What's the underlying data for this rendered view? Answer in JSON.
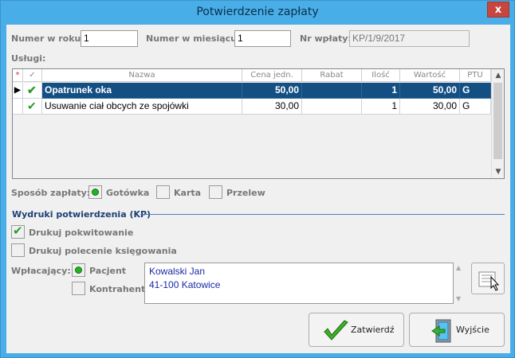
{
  "window": {
    "title": "Potwierdzenie zapłaty",
    "close_glyph": "x"
  },
  "fields": {
    "numer_w_roku_label": "Numer w roku:",
    "numer_w_roku_value": "1",
    "numer_w_miesiacu_label": "Numer w miesiącu:",
    "numer_w_miesiacu_value": "1",
    "nr_wplaty_label": "Nr wpłaty:",
    "nr_wplaty_value": "KP/1/9/2017"
  },
  "services": {
    "label": "Usługi:",
    "columns": [
      "*",
      "✓",
      "Nazwa",
      "Cena jedn.",
      "Rabat",
      "Ilość",
      "Wartość",
      "PTU"
    ],
    "rows": [
      {
        "name": "Opatrunek oka",
        "price": "50,00",
        "discount": "",
        "qty": "1",
        "value": "50,00",
        "ptu": "G"
      },
      {
        "name": "Usuwanie ciał obcych ze spojówki",
        "price": "30,00",
        "discount": "",
        "qty": "1",
        "value": "30,00",
        "ptu": "G"
      }
    ]
  },
  "payment": {
    "label": "Sposób zapłaty:",
    "options": [
      "Gotówka",
      "Karta",
      "Przelew"
    ],
    "selected": "Gotówka"
  },
  "prints": {
    "title": "Wydruki potwierdzenia (KP)",
    "drukuj_pokwitowanie": "Drukuj pokwitowanie",
    "drukuj_pokwitowanie_checked": true,
    "drukuj_polecenie": "Drukuj polecenie księgowania",
    "drukuj_polecenie_checked": false
  },
  "payer": {
    "label": "Wpłacający:",
    "options": [
      "Pacjent",
      "Kontrahent"
    ],
    "selected": "Pacjent",
    "address_line1": "Kowalski Jan",
    "address_line2": "41-100 Katowice"
  },
  "buttons": {
    "confirm": "Zatwierdź",
    "exit": "Wyjście"
  },
  "colors": {
    "title_bar": "#49aee8",
    "selected_row": "#134f83",
    "close_button": "#c7463e",
    "radio_on": "#22b322"
  }
}
